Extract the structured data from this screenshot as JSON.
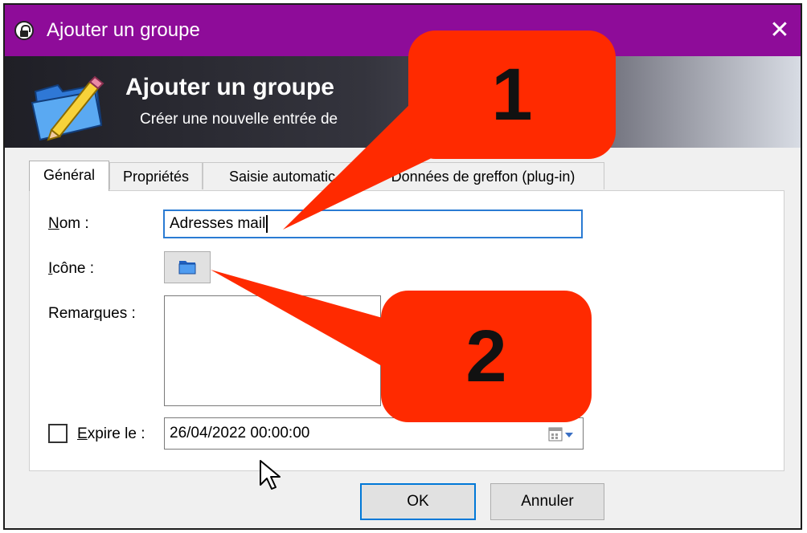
{
  "window": {
    "title": "Ajouter un groupe",
    "close_glyph": "✕"
  },
  "banner": {
    "title": "Ajouter un groupe",
    "subtitle": "Créer une nouvelle entrée de"
  },
  "tabs": [
    {
      "label": "Général",
      "active": true
    },
    {
      "label": "Propriétés",
      "active": false
    },
    {
      "label": "Saisie automatic",
      "active": false
    },
    {
      "label": "Données de greffon (plug-in)",
      "active": false
    }
  ],
  "form": {
    "name_label_mnemonic": "N",
    "name_label_rest": "om :",
    "name_value": "Adresses mail",
    "icon_label_mnemonic": "I",
    "icon_label_rest": "cône :",
    "remarks_label_pre": "Remar",
    "remarks_label_mnemonic": "q",
    "remarks_label_rest": "ues :",
    "remarks_value": "",
    "expires_label_mnemonic": "E",
    "expires_label_rest": "xpire le :",
    "expires_checked": false,
    "expires_value": "26/04/2022 00:00:00"
  },
  "buttons": {
    "ok": "OK",
    "cancel": "Annuler"
  },
  "callouts": [
    {
      "number": "1"
    },
    {
      "number": "2"
    }
  ],
  "colors": {
    "titlebar": "#8e0c99",
    "callout": "#ff2a00",
    "focus_border": "#2a7bd3"
  },
  "icons": {
    "app": "lock-icon",
    "banner": "folder-pencil-icon",
    "group_icon": "folder-icon",
    "calendar": "calendar-dropdown-icon",
    "cursor": "mouse-pointer-icon"
  }
}
